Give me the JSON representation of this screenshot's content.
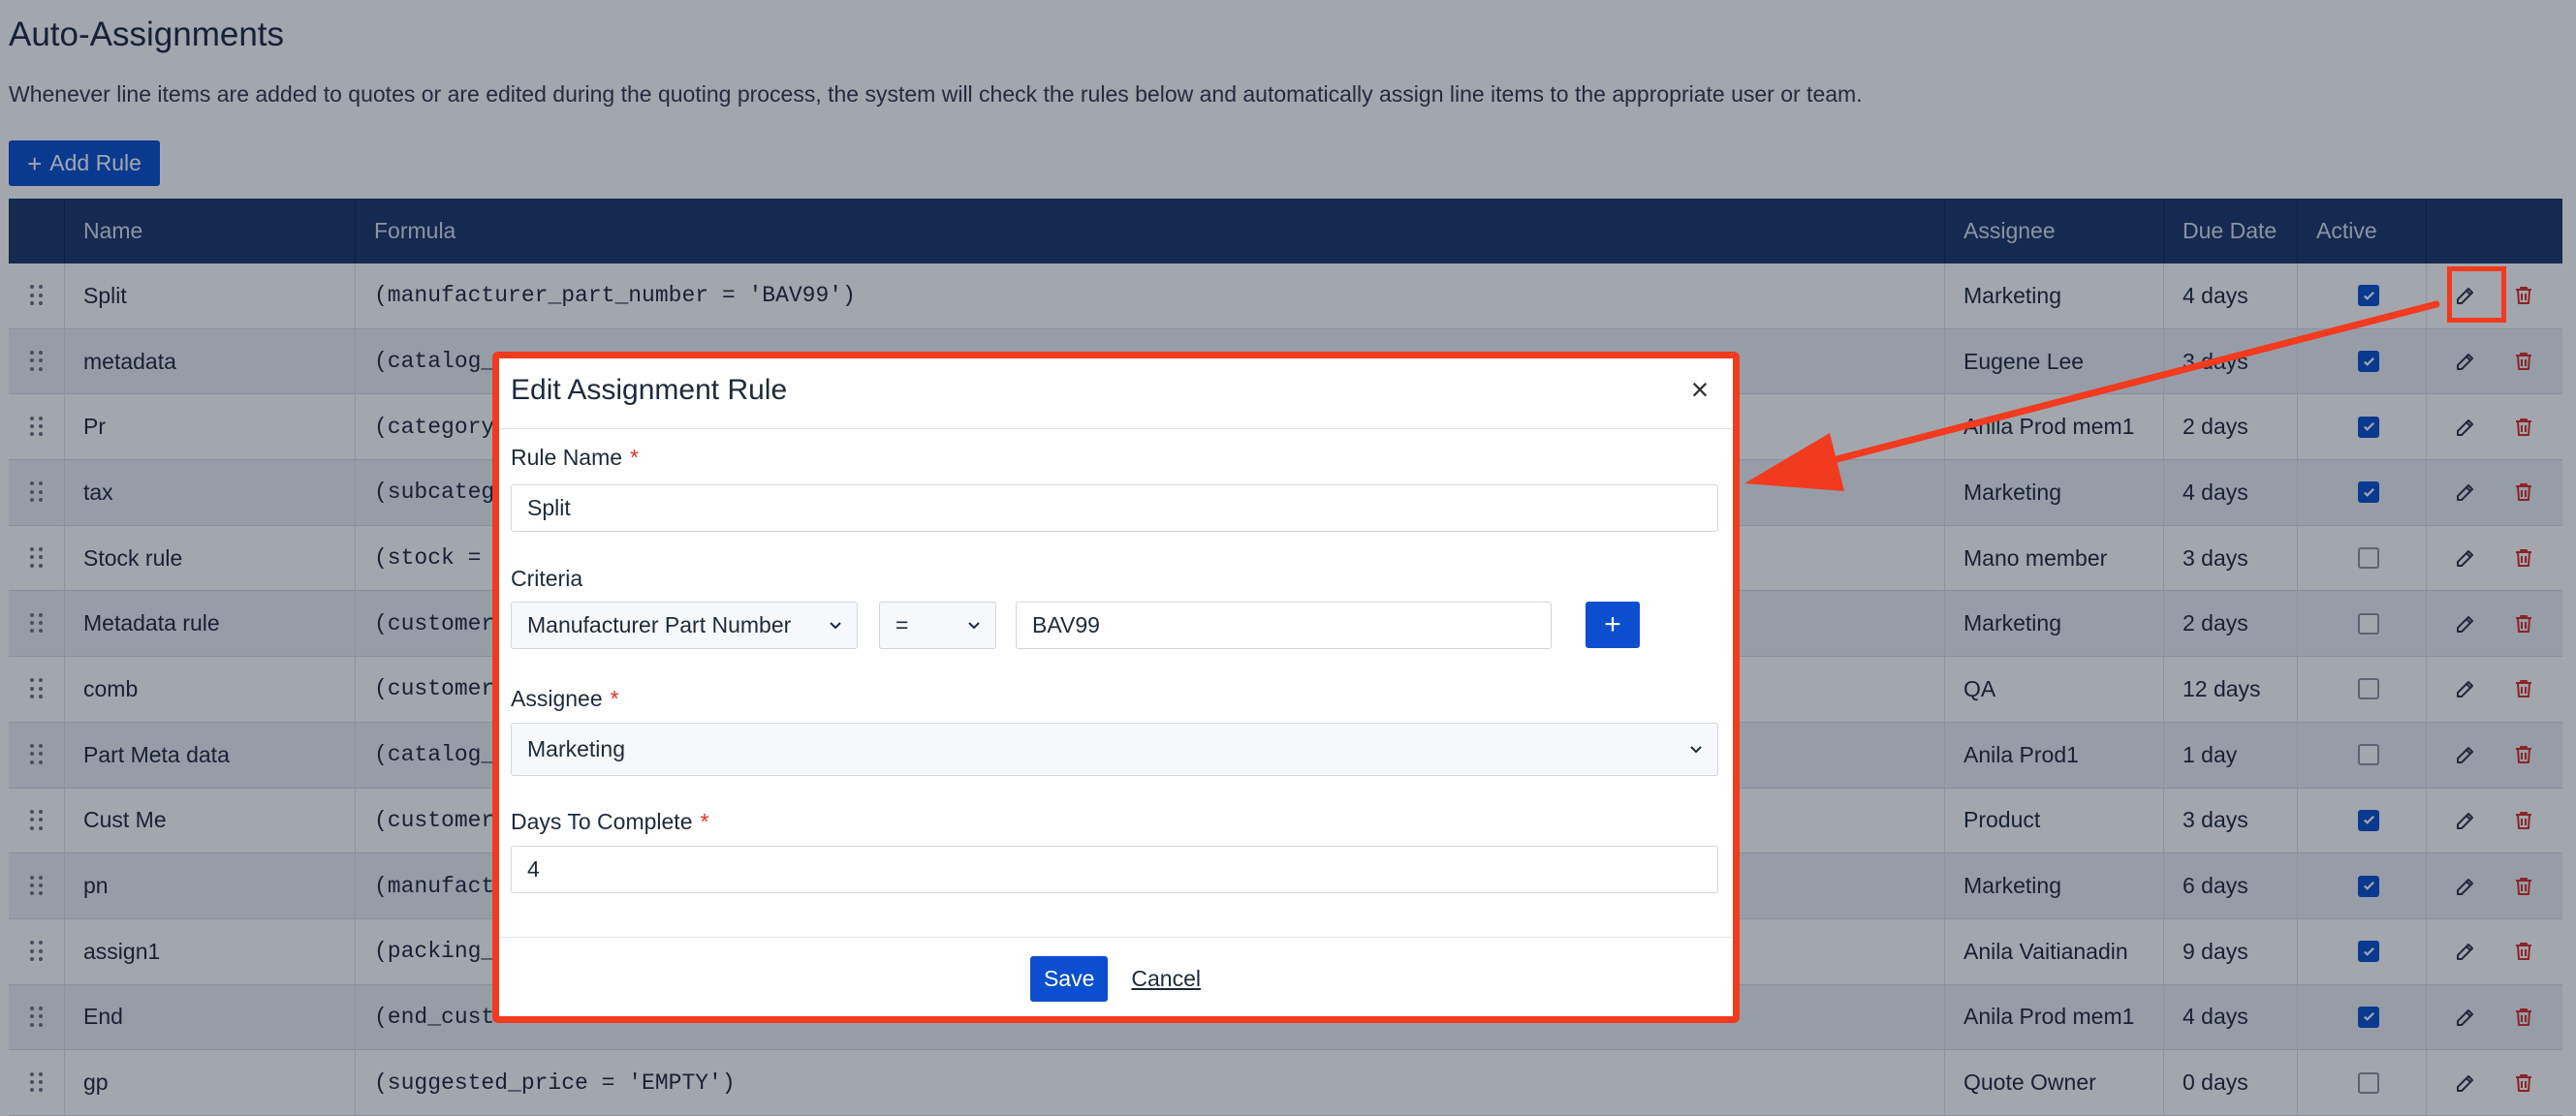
{
  "page": {
    "title": "Auto-Assignments",
    "description": "Whenever line items are added to quotes or are edited during the quoting process, the system will check the rules below and automatically assign line items to the appropriate user or team.",
    "add_rule_label": "Add Rule"
  },
  "table": {
    "columns": [
      "Name",
      "Formula",
      "Assignee",
      "Due Date",
      "Active"
    ],
    "rows": [
      {
        "name": "Split",
        "formula": "(manufacturer_part_number = 'BAV99')",
        "assignee": "Marketing",
        "due": "4 days",
        "active": true
      },
      {
        "name": "metadata",
        "formula": "(catalog_",
        "assignee": "Eugene Lee",
        "due": "3 days",
        "active": true
      },
      {
        "name": "Pr",
        "formula": "(category",
        "assignee": "Anila Prod mem1",
        "due": "2 days",
        "active": true
      },
      {
        "name": "tax",
        "formula": "(subcateg",
        "assignee": "Marketing",
        "due": "4 days",
        "active": true
      },
      {
        "name": "Stock rule",
        "formula": "(stock = ",
        "assignee": "Mano member",
        "due": "3 days",
        "active": false
      },
      {
        "name": "Metadata rule",
        "formula": "(customer",
        "assignee": "Marketing",
        "due": "2 days",
        "active": false
      },
      {
        "name": "comb",
        "formula": "(customer",
        "assignee": "QA",
        "due": "12 days",
        "active": false
      },
      {
        "name": "Part Meta data",
        "formula": "(catalog_",
        "assignee": "Anila Prod1",
        "due": "1 day",
        "active": false
      },
      {
        "name": "Cust Me",
        "formula": "(customer",
        "assignee": "Product",
        "due": "3 days",
        "active": true
      },
      {
        "name": "pn",
        "formula": "(manufact",
        "assignee": "Marketing",
        "due": "6 days",
        "active": true
      },
      {
        "name": "assign1",
        "formula": "(packing_",
        "assignee": "Anila Vaitianadin",
        "due": "9 days",
        "active": true
      },
      {
        "name": "End",
        "formula": "(end_custo",
        "assignee": "Anila Prod mem1",
        "due": "4 days",
        "active": true
      },
      {
        "name": "gp",
        "formula": "(suggested_price = 'EMPTY')",
        "assignee": "Quote Owner",
        "due": "0 days",
        "active": false
      }
    ]
  },
  "modal": {
    "title": "Edit Assignment Rule",
    "close_glyph": "×",
    "rule_name_label": "Rule Name",
    "rule_name_value": "Split",
    "criteria_label": "Criteria",
    "criteria_field": "Manufacturer Part Number",
    "criteria_operator": "=",
    "criteria_value": "BAV99",
    "criteria_add_glyph": "+",
    "assignee_label": "Assignee",
    "assignee_value": "Marketing",
    "days_label": "Days To Complete",
    "days_value": "4",
    "required_mark": "*",
    "save_label": "Save",
    "cancel_label": "Cancel"
  },
  "colors": {
    "header_bg": "#1a3869",
    "primary": "#0b4fd0",
    "annotation": "#f23a1f",
    "delete": "#d9302c"
  },
  "icons": [
    "drag-handle-icon",
    "pencil-icon",
    "trash-icon",
    "check-icon",
    "chevron-down-icon",
    "close-icon",
    "plus-icon"
  ]
}
